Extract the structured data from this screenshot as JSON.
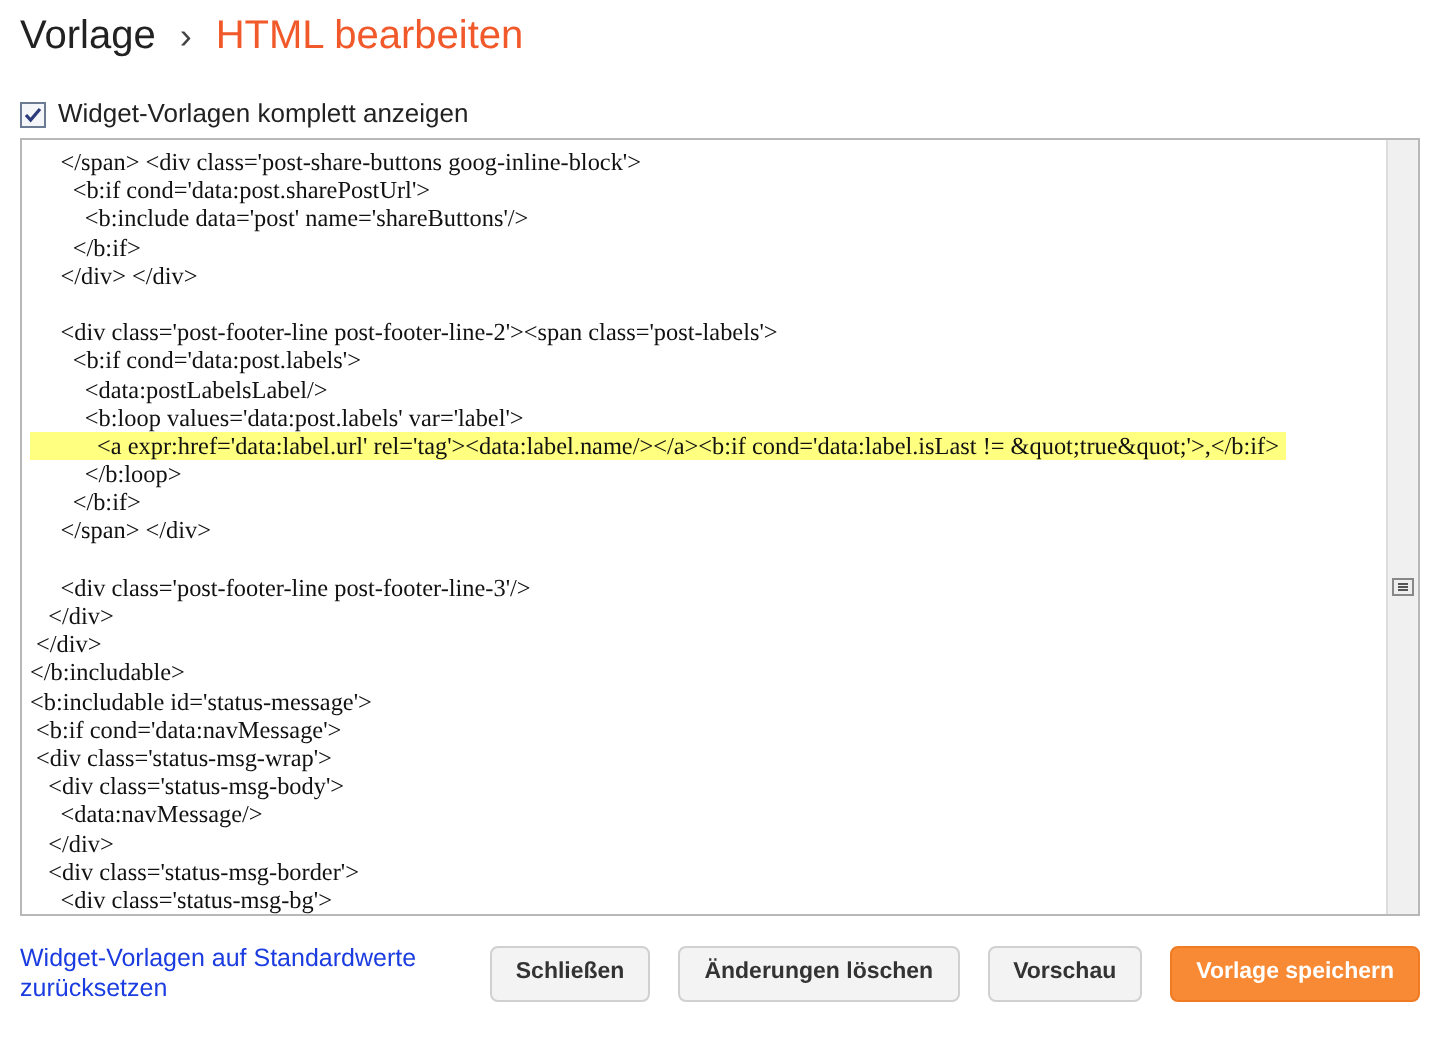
{
  "breadcrumb": {
    "parent": "Vorlage",
    "separator": "›",
    "current": "HTML bearbeiten"
  },
  "option": {
    "label": "Widget-Vorlagen komplett anzeigen",
    "checked": true
  },
  "editor": {
    "lines": [
      {
        "text": "     </span> <div class='post-share-buttons goog-inline-block'>",
        "highlighted": false
      },
      {
        "text": "       <b:if cond='data:post.sharePostUrl'>",
        "highlighted": false
      },
      {
        "text": "         <b:include data='post' name='shareButtons'/>",
        "highlighted": false
      },
      {
        "text": "       </b:if>",
        "highlighted": false
      },
      {
        "text": "     </div> </div>",
        "highlighted": false
      },
      {
        "text": "     <div class='post-footer-line post-footer-line-2'><span class='post-labels'>",
        "highlighted": false,
        "blank_line_before": true
      },
      {
        "text": "       <b:if cond='data:post.labels'>",
        "highlighted": false
      },
      {
        "text": "         <data:postLabelsLabel/>",
        "highlighted": false
      },
      {
        "text": "         <b:loop values='data:post.labels' var='label'>",
        "highlighted": false
      },
      {
        "text": "           <a expr:href='data:label.url' rel='tag'><data:label.name/></a><b:if cond='data:label.isLast != &quot;true&quot;'>,</b:if>",
        "highlighted": true
      },
      {
        "text": "         </b:loop>",
        "highlighted": false
      },
      {
        "text": "       </b:if>",
        "highlighted": false
      },
      {
        "text": "     </span> </div>",
        "highlighted": false
      },
      {
        "text": "     <div class='post-footer-line post-footer-line-3'/>",
        "highlighted": false,
        "blank_line_before": true
      },
      {
        "text": "   </div>",
        "highlighted": false
      },
      {
        "text": " </div>",
        "highlighted": false
      },
      {
        "text": "</b:includable>",
        "highlighted": false
      },
      {
        "text": "<b:includable id='status-message'>",
        "highlighted": false
      },
      {
        "text": " <b:if cond='data:navMessage'>",
        "highlighted": false
      },
      {
        "text": " <div class='status-msg-wrap'>",
        "highlighted": false
      },
      {
        "text": "   <div class='status-msg-body'>",
        "highlighted": false
      },
      {
        "text": "     <data:navMessage/>",
        "highlighted": false
      },
      {
        "text": "   </div>",
        "highlighted": false
      },
      {
        "text": "   <div class='status-msg-border'>",
        "highlighted": false
      },
      {
        "text": "     <div class='status-msg-bg'>",
        "highlighted": false
      }
    ]
  },
  "reset_link": "Widget-Vorlagen auf Standardwerte zurücksetzen",
  "buttons": [
    {
      "label": "Schließen",
      "kind": "default"
    },
    {
      "label": "Änderungen löschen",
      "kind": "default"
    },
    {
      "label": "Vorschau",
      "kind": "default"
    },
    {
      "label": "Vorlage speichern",
      "kind": "primary"
    }
  ]
}
